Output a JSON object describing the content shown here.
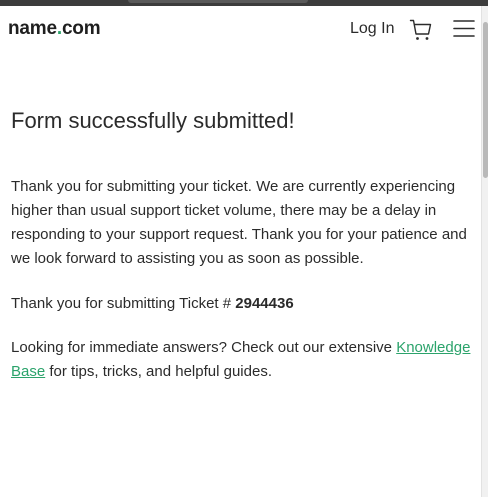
{
  "header": {
    "logo": {
      "prefix": "name",
      "dot": ".",
      "suffix": "com"
    },
    "login_label": "Log In",
    "cart_icon": "cart-icon",
    "menu_icon": "hamburger-menu-icon"
  },
  "content": {
    "title": "Form successfully submitted!",
    "message": "Thank you for submitting your ticket. We are currently experiencing higher than usual support ticket volume, there may be a delay in responding to your support request. Thank you for your patience and we look forward to assisting you as soon as possible.",
    "ticket_prefix": "Thank you for submitting Ticket # ",
    "ticket_number": "2944436",
    "help_prefix": "Looking for immediate answers? Check out our extensive ",
    "help_link": "Knowledge Base",
    "help_suffix": " for tips, tricks, and helpful guides."
  },
  "colors": {
    "accent": "#2ba36b",
    "text": "#2b2b2b"
  }
}
